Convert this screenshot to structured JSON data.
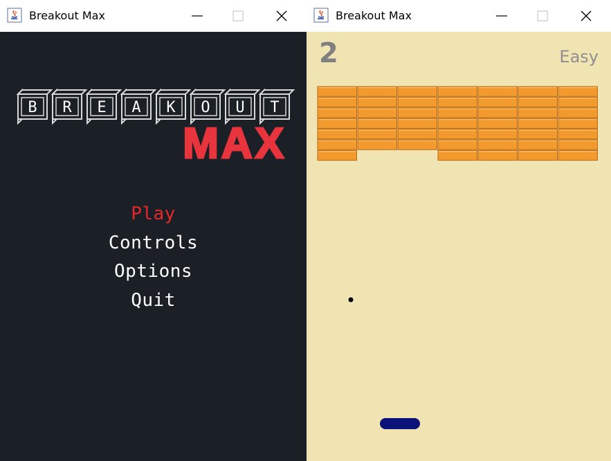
{
  "windows": [
    {
      "title": "Breakout Max"
    },
    {
      "title": "Breakout Max"
    }
  ],
  "menu": {
    "logo_title_letters": [
      "B",
      "R",
      "E",
      "A",
      "K",
      "O",
      "U",
      "T"
    ],
    "logo_subtitle": "MAX",
    "items": [
      {
        "label": "Play",
        "selected": true
      },
      {
        "label": "Controls",
        "selected": false
      },
      {
        "label": "Options",
        "selected": false
      },
      {
        "label": "Quit",
        "selected": false
      }
    ]
  },
  "game": {
    "lives": "2",
    "difficulty": "Easy",
    "brick_columns": 7,
    "brick_rows": [
      [
        1,
        1,
        1,
        1,
        1,
        1,
        1
      ],
      [
        1,
        1,
        1,
        1,
        1,
        1,
        1
      ],
      [
        1,
        1,
        1,
        1,
        1,
        1,
        1
      ],
      [
        1,
        1,
        1,
        1,
        1,
        1,
        1
      ],
      [
        1,
        1,
        1,
        1,
        1,
        1,
        1
      ],
      [
        1,
        1,
        1,
        1,
        1,
        1,
        1
      ],
      [
        1,
        0,
        0,
        1,
        1,
        1,
        1
      ]
    ]
  },
  "colors": {
    "menu_bg": "#1b1f26",
    "menu_text": "#ffffff",
    "menu_selected": "#e8272a",
    "logo_max": "#e8343d",
    "game_bg": "#f1e4b3",
    "brick": "#f39a2e",
    "brick_light": "#ffc06a",
    "brick_dark": "#b86a16",
    "paddle": "#0b127a",
    "ball": "#000000"
  }
}
